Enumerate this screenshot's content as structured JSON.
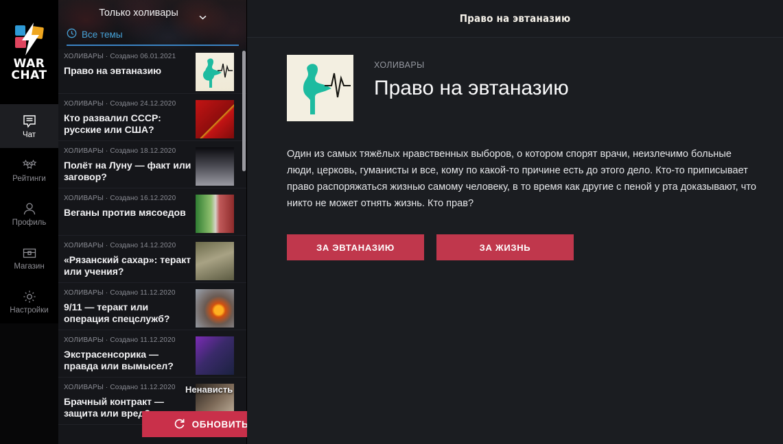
{
  "brand": {
    "name_line1": "WAR",
    "name_line2": "CHAT",
    "logo_colors": {
      "blue": "#2e9ad6",
      "yellow": "#efa61f",
      "red": "#e0455f",
      "bolt": "#ffffff"
    }
  },
  "nav": {
    "items": [
      {
        "label": "Чат",
        "icon": "chat-icon",
        "active": true
      },
      {
        "label": "Рейтинги",
        "icon": "stars-icon",
        "active": false
      },
      {
        "label": "Профиль",
        "icon": "person-icon",
        "active": false
      },
      {
        "label": "Магазин",
        "icon": "chest-icon",
        "active": false
      },
      {
        "label": "Настройки",
        "icon": "gear-icon",
        "active": false
      }
    ]
  },
  "list_panel": {
    "filter_label": "Только холивары",
    "filter_icon": "chevron-down-icon",
    "tab_label": "Все темы",
    "tab_icon": "clock-icon",
    "overlay_label": "Ненависть",
    "fab_label": "+",
    "refresh_label": "ОБНОВИТЬ",
    "refresh_icon": "refresh-icon",
    "topics": [
      {
        "category": "ХОЛИВАРЫ",
        "created": "Создано 06.01.2021",
        "title": "Право на эвтаназию",
        "thumb": "th-eut"
      },
      {
        "category": "ХОЛИВАРЫ",
        "created": "Создано 24.12.2020",
        "title": "Кто развалил СССР: русские или США?",
        "thumb": "th-ussr"
      },
      {
        "category": "ХОЛИВАРЫ",
        "created": "Создано 18.12.2020",
        "title": "Полёт на Луну — факт или заговор?",
        "thumb": "th-moon"
      },
      {
        "category": "ХОЛИВАРЫ",
        "created": "Создано 16.12.2020",
        "title": "Веганы против мясоедов",
        "thumb": "th-vegan"
      },
      {
        "category": "ХОЛИВАРЫ",
        "created": "Создано 14.12.2020",
        "title": "«Рязанский сахар»: теракт или учения?",
        "thumb": "th-sugar"
      },
      {
        "category": "ХОЛИВАРЫ",
        "created": "Создано 11.12.2020",
        "title": "9/11 — теракт или операция спецслужб?",
        "thumb": "th-911"
      },
      {
        "category": "ХОЛИВАРЫ",
        "created": "Создано 11.12.2020",
        "title": "Экстрасенсорика — правда или вымысел?",
        "thumb": "th-esp"
      },
      {
        "category": "ХОЛИВАРЫ",
        "created": "Создано 11.12.2020",
        "title": "Брачный контракт — защита или вред?",
        "thumb": "th-contract"
      }
    ]
  },
  "main": {
    "header_title": "Право на эвтаназию",
    "kicker": "ХОЛИВАРЫ",
    "title": "Право на эвтаназию",
    "body": "Один из самых тяжёлых нравственных выборов, о котором спорят врачи, неизлечимо больные люди, церковь, гуманисты и все, кому по какой-то причине есть до этого дело. Кто-то приписывает право распоряжаться жизнью самому человеку, в то время как другие с пеной у рта доказывают, что никто не может отнять жизнь. Кто прав?",
    "choices": [
      {
        "label": "ЗА ЭВТАНАЗИЮ"
      },
      {
        "label": "ЗА ЖИЗНЬ"
      }
    ],
    "accent_color": "#c0374c"
  }
}
